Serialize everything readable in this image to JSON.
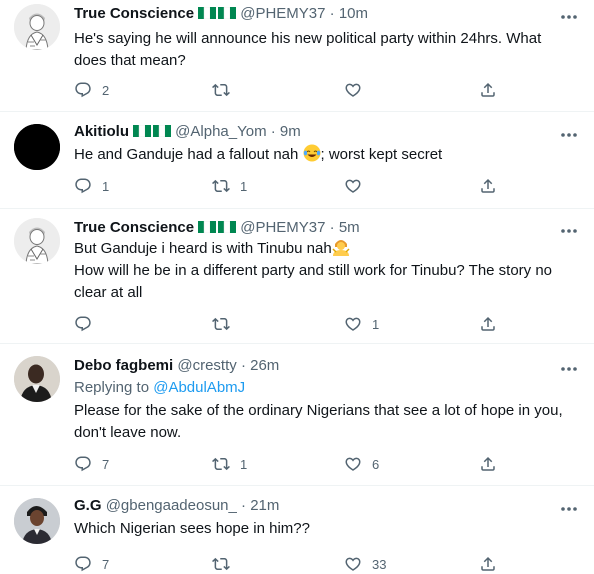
{
  "tweets": [
    {
      "name": "True Conscience",
      "handle": "@PHEMY37",
      "sep": "·",
      "time": "10m",
      "reply_to_prefix": "",
      "reply_to_user": "",
      "text_lines": [
        "He's saying he will announce his new political party within 24hrs. What",
        "does that mean?"
      ],
      "replies": "2",
      "retweets": "",
      "likes": ""
    },
    {
      "name": "Akitiolu",
      "handle": "@Alpha_Yom",
      "sep": "·",
      "time": "9m",
      "text_lines": [
        "He and Ganduje had a fallout nah",
        "; worst kept secret"
      ],
      "replies": "1",
      "retweets": "1",
      "likes": ""
    },
    {
      "name": "True Conscience",
      "handle": "@PHEMY37",
      "sep": "·",
      "time": "5m",
      "text_lines": [
        "But Ganduje i heard is with Tinubu nah",
        "How will he be in a different party and still work for Tinubu? The story no",
        "clear at all"
      ],
      "replies": "",
      "retweets": "",
      "likes": "1"
    },
    {
      "name": "Debo fagbemi",
      "handle": "@crestty",
      "sep": "·",
      "time": "26m",
      "reply_to_prefix": "Replying to ",
      "reply_to_user": "@AbdulAbmJ",
      "text_lines": [
        "Please for the sake of the ordinary Nigerians that see a lot of hope in you,",
        "don't leave now."
      ],
      "replies": "7",
      "retweets": "1",
      "likes": "6"
    },
    {
      "name": "G.G",
      "handle": "@gbengaadeosun_",
      "sep": "·",
      "time": "21m",
      "text_lines": [
        "Which Nigerian sees hope in him??"
      ],
      "replies": "7",
      "retweets": "",
      "likes": "33"
    }
  ],
  "icons": {
    "reply": "reply-icon",
    "retweet": "retweet-icon",
    "like": "heart-icon",
    "share": "share-icon",
    "more": "more-dots-icon",
    "flag": "nigeria-flag-icon"
  },
  "colors": {
    "text": "#0f1419",
    "secondary": "#536471",
    "link": "#1d9bf0",
    "divider": "#eff3f4",
    "flag_green": "#008751"
  }
}
